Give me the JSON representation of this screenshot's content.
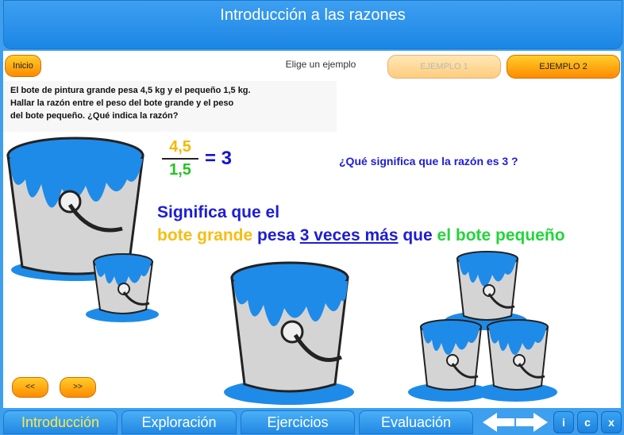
{
  "window": {
    "title": "Introducción a las razones"
  },
  "header": {
    "inicio_label": "Inicio",
    "elige_label": "Elige un ejemplo",
    "ejemplo1_label": "EJEMPLO 1",
    "ejemplo2_label": "EJEMPLO 2"
  },
  "problem": {
    "line1": "El bote de pintura grande pesa  4,5 kg   y el pequeño 1,5 kg.",
    "line2": "Hallar la razón entre el peso  del bote grande y  el peso",
    "line3": "del bote pequeño.  ¿Qué indica la razón?"
  },
  "math": {
    "numerator": "4,5",
    "denominator": "1,5",
    "result": "= 3",
    "question": "¿Qué significa que la razón es 3 ?"
  },
  "meaning": {
    "line1": "Significa que el",
    "part_a": "bote grande",
    "part_b": " pesa ",
    "part_c": "3 veces más",
    "part_d": " que ",
    "part_e": "el bote pequeño"
  },
  "nav_arrows": {
    "prev_label": "<<",
    "next_label": ">>"
  },
  "bottom_nav": {
    "tabs": [
      {
        "label": "Introducción"
      },
      {
        "label": "Exploración"
      },
      {
        "label": "Ejercicios"
      },
      {
        "label": "Evaluación"
      }
    ],
    "i_label": "i",
    "c_label": "c",
    "x_label": "x"
  },
  "colors": {
    "paint_blue": "#1f8be8",
    "accent_orange": "#ff9800",
    "title_blue": "#2a93ec"
  }
}
